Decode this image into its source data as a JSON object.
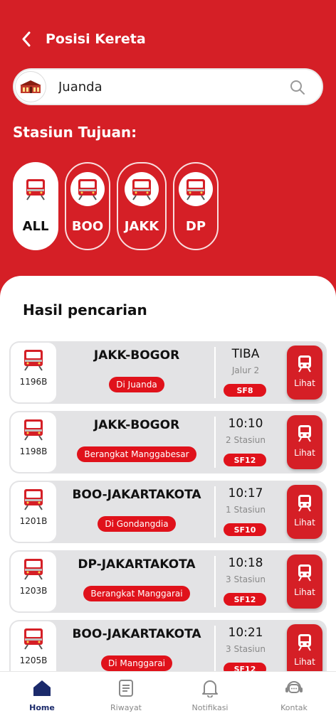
{
  "header": {
    "title": "Posisi Kereta"
  },
  "search": {
    "value": "Juanda",
    "placeholder": "Cari stasiun"
  },
  "destination": {
    "title": "Stasiun Tujuan:",
    "chips": [
      "ALL",
      "BOO",
      "JAKK",
      "DP"
    ],
    "selected": "ALL"
  },
  "results": {
    "title": "Hasil pencarian",
    "items": [
      {
        "train": "1196B",
        "route": "JAKK-BOGOR",
        "status": "Di Juanda",
        "time": "TIBA",
        "sub": "Jalur 2",
        "sf": "SF8",
        "action": "Lihat"
      },
      {
        "train": "1198B",
        "route": "JAKK-BOGOR",
        "status": "Berangkat Manggabesar",
        "time": "10:10",
        "sub": "2 Stasiun",
        "sf": "SF12",
        "action": "Lihat"
      },
      {
        "train": "1201B",
        "route": "BOO-JAKARTAKOTA",
        "status": "Di Gondangdia",
        "time": "10:17",
        "sub": "1 Stasiun",
        "sf": "SF10",
        "action": "Lihat"
      },
      {
        "train": "1203B",
        "route": "DP-JAKARTAKOTA",
        "status": "Berangkat Manggarai",
        "time": "10:18",
        "sub": "3 Stasiun",
        "sf": "SF12",
        "action": "Lihat"
      },
      {
        "train": "1205B",
        "route": "BOO-JAKARTAKOTA",
        "status": "Di Manggarai",
        "time": "10:21",
        "sub": "3 Stasiun",
        "sf": "SF12",
        "action": "Lihat"
      }
    ]
  },
  "nav": {
    "items": [
      "Home",
      "Riwayat",
      "Notifikasi",
      "Kontak"
    ],
    "active": "Home"
  },
  "colors": {
    "primary": "#d51f26",
    "badge": "#e0121b",
    "nav_active": "#1b2a6b"
  }
}
